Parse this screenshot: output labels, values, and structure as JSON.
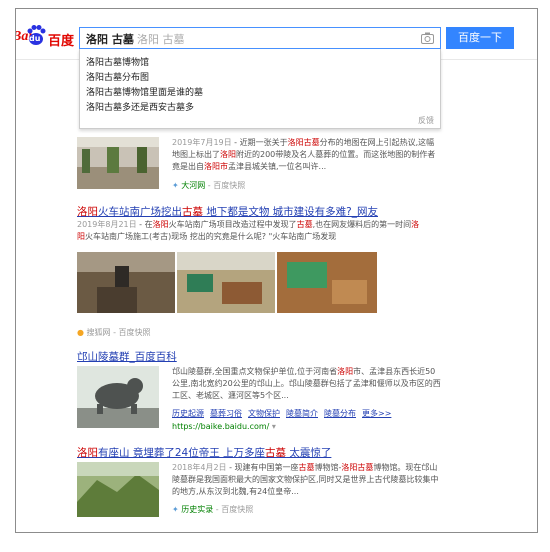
{
  "logo": {
    "bai": "Bai",
    "du": "du",
    "cn": "百度"
  },
  "search": {
    "query": "洛阳 古墓",
    "ghost": "洛阳 古墓",
    "button": "百度一下"
  },
  "suggestions": {
    "items": [
      "洛阳古墓博物馆",
      "洛阳古墓分布图",
      "洛阳古墓博物馆里面是谁的墓",
      "洛阳古墓多还是西安古墓多"
    ],
    "feedback": "反馈"
  },
  "results": [
    {
      "title": "",
      "abstract_parts": [
        {
          "t": "2019年7月19日",
          "k": "d"
        },
        {
          "t": " - 近期一张关于",
          "k": ""
        },
        {
          "t": "洛阳古墓",
          "k": "em"
        },
        {
          "t": "分布的地图在网上引起热议,这幅地图上标出了",
          "k": ""
        },
        {
          "t": "洛阳",
          "k": "em"
        },
        {
          "t": "附近的200带陵及名人墓葬的位置。而这张地图的制作者竟是出自",
          "k": ""
        },
        {
          "t": "洛阳市",
          "k": "em"
        },
        {
          "t": "孟津县城关镇,一位名叫许...",
          "k": ""
        }
      ],
      "source": "大河网",
      "snapshot": "百度快照"
    },
    {
      "title_parts": [
        {
          "t": "洛阳",
          "k": "em"
        },
        {
          "t": "火车站南广场挖出",
          "k": ""
        },
        {
          "t": "古墓",
          "k": "em"
        },
        {
          "t": " 地下都是文物 城市建设有多难?_网友",
          "k": ""
        }
      ],
      "abstract_parts": [
        {
          "t": "2019年8月21日",
          "k": "d"
        },
        {
          "t": " - 在",
          "k": ""
        },
        {
          "t": "洛阳",
          "k": "em"
        },
        {
          "t": "火车站南广场项目改造过程中发现了",
          "k": ""
        },
        {
          "t": "古墓",
          "k": "em"
        },
        {
          "t": ",也在网友爆料后的第一时间",
          "k": ""
        },
        {
          "t": "洛阳",
          "k": "em"
        },
        {
          "t": "火车站南广场施工(考古)现场 挖出的究竟是什么呢? \"火车站南广场发现",
          "k": ""
        }
      ],
      "source": "搜狐网",
      "snapshot": "百度快照"
    },
    {
      "title_parts": [
        {
          "t": "邙山陵墓群_百度百科",
          "k": ""
        }
      ],
      "abstract_parts": [
        {
          "t": "邙山陵墓群,全国重点文物保护单位,位于河南省",
          "k": ""
        },
        {
          "t": "洛阳",
          "k": "em"
        },
        {
          "t": "市、孟津县东西长近50公里,南北宽约20公里的邙山上。邙山陵墓群包括了孟津和偃师以及市区的西工区、老城区、瀍河区等5个区...",
          "k": ""
        }
      ],
      "links": [
        "历史起源",
        "墓葬习俗",
        "文物保护",
        "陵墓简介",
        "陵墓分布",
        "更多>>"
      ],
      "url": "https://baike.baidu.com/"
    },
    {
      "title_parts": [
        {
          "t": "洛阳",
          "k": "em"
        },
        {
          "t": "有座山 竟埋葬了24位帝王 上万多座",
          "k": ""
        },
        {
          "t": "古墓",
          "k": "em"
        },
        {
          "t": " 太震惊了",
          "k": ""
        }
      ],
      "abstract_parts": [
        {
          "t": "2018年4月2日",
          "k": "d"
        },
        {
          "t": " - 现建有中国第一座",
          "k": ""
        },
        {
          "t": "古墓",
          "k": "em"
        },
        {
          "t": "博物馆-",
          "k": ""
        },
        {
          "t": "洛阳古墓",
          "k": "em"
        },
        {
          "t": "博物馆。现在邙山陵墓群是我国面积最大的国家文物保护区,同时又是世界上古代陵墓比较集中的地方,从东汉到北魏,有24位皇帝...",
          "k": ""
        }
      ],
      "source": "历史实录",
      "snapshot": "百度快照"
    }
  ],
  "colors": {
    "link": "#2440b3",
    "highlight": "#cc0000",
    "button": "#3385ff",
    "green": "#008000"
  }
}
